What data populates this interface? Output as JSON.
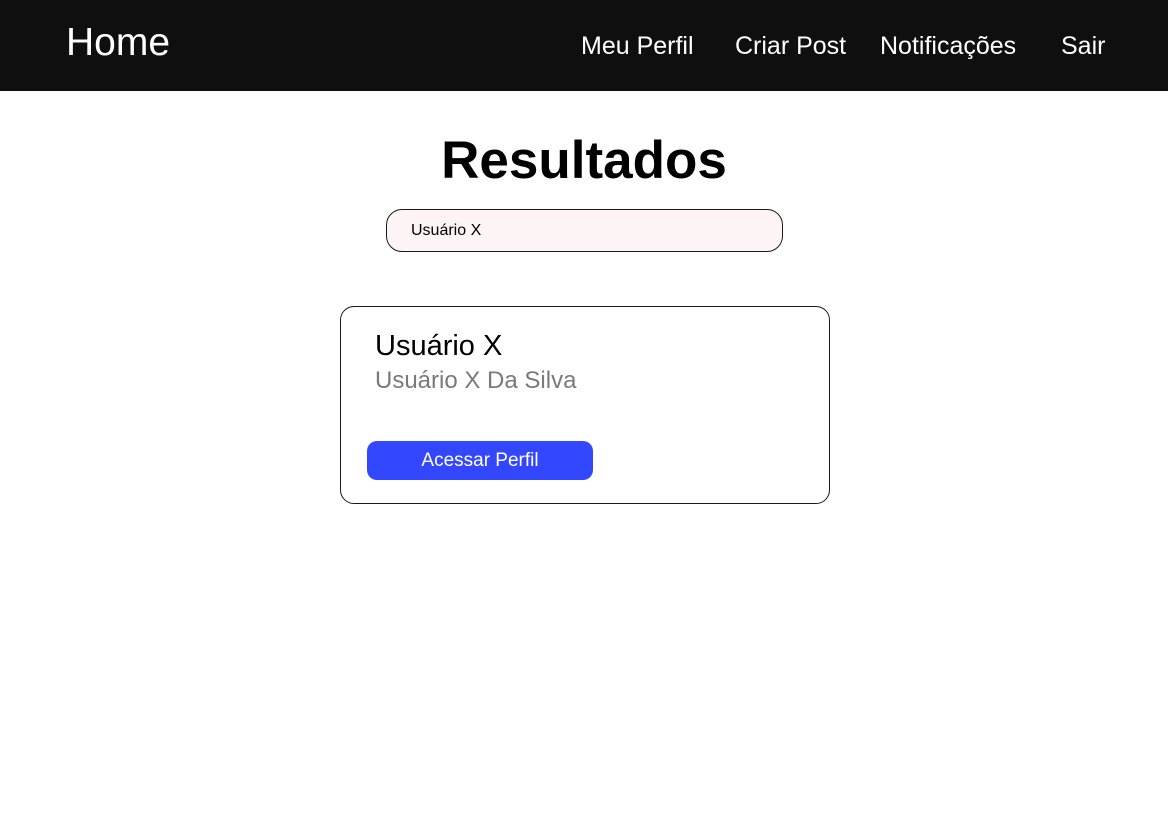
{
  "navbar": {
    "home_label": "Home",
    "links": [
      {
        "label": "Meu Perfil"
      },
      {
        "label": "Criar Post"
      },
      {
        "label": "Notificações"
      },
      {
        "label": "Sair"
      }
    ]
  },
  "main": {
    "title": "Resultados",
    "search": {
      "value": "Usuário X"
    },
    "results": [
      {
        "username": "Usuário X",
        "full_name": "Usuário X Da Silva",
        "button_label": "Acessar Perfil"
      }
    ]
  },
  "colors": {
    "navbar_bg": "#0f0f0f",
    "accent_button": "#3347ff",
    "search_bg": "#fdf5f5",
    "secondary_text": "#7a7a7a"
  }
}
